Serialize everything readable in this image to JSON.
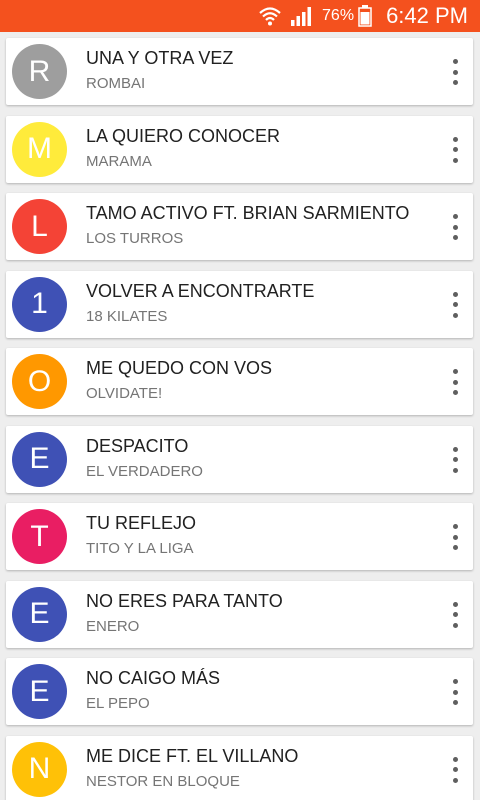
{
  "status_bar": {
    "battery_percent": "76%",
    "time": "6:42 PM",
    "icons": [
      "wifi-icon",
      "signal-icon",
      "battery-icon"
    ],
    "color": "#f4511e"
  },
  "songs": [
    {
      "letter": "R",
      "title": "UNA Y OTRA VEZ",
      "artist": "ROMBAI",
      "color": "#9e9e9e"
    },
    {
      "letter": "M",
      "title": "LA QUIERO CONOCER",
      "artist": "MARAMA",
      "color": "#ffeb3b"
    },
    {
      "letter": "L",
      "title": "TAMO ACTIVO FT. BRIAN SARMIENTO",
      "artist": "LOS TURROS",
      "color": "#f44336"
    },
    {
      "letter": "1",
      "title": "VOLVER A ENCONTRARTE",
      "artist": "18 KILATES",
      "color": "#3f51b5"
    },
    {
      "letter": "O",
      "title": "ME QUEDO CON VOS",
      "artist": "OLVIDATE!",
      "color": "#ff9800"
    },
    {
      "letter": "E",
      "title": "DESPACITO",
      "artist": "EL VERDADERO",
      "color": "#3f51b5"
    },
    {
      "letter": "T",
      "title": "TU REFLEJO",
      "artist": "TITO Y LA LIGA",
      "color": "#e91e63"
    },
    {
      "letter": "E",
      "title": "NO ERES PARA TANTO",
      "artist": "ENERO",
      "color": "#3f51b5"
    },
    {
      "letter": "E",
      "title": "NO CAIGO MÁS",
      "artist": "EL PEPO",
      "color": "#3f51b5"
    },
    {
      "letter": "N",
      "title": "ME DICE FT. EL VILLANO",
      "artist": "NESTOR EN BLOQUE",
      "color": "#ffc107"
    }
  ]
}
